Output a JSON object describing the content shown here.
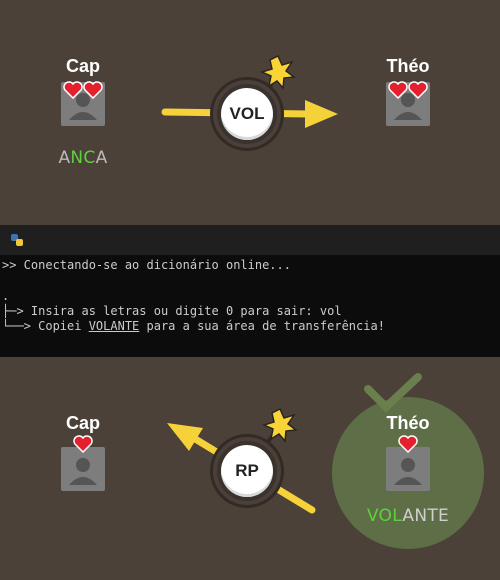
{
  "top_panel": {
    "left_player": {
      "name": "Cap",
      "hearts": 2,
      "word_prefix": "A",
      "word_highlight": "NC",
      "word_suffix": "A"
    },
    "right_player": {
      "name": "Théo",
      "hearts": 2
    },
    "bomb_label": "VOL",
    "arrow_direction": "right"
  },
  "console": {
    "titlebar_icon": "python-icon",
    "line1": ">> Conectando-se ao dicionário online...",
    "line2": ".",
    "line3": "├─> Insira as letras ou digite 0 para sair: vol",
    "line4_prefix": "└──> Copiei ",
    "line4_word": "VOLANTE",
    "line4_suffix": " para a sua área de transferência!"
  },
  "bottom_panel": {
    "left_player": {
      "name": "Cap",
      "hearts": 1
    },
    "right_player": {
      "name": "Théo",
      "hearts": 1,
      "word_highlight": "VOL",
      "word_rest": "ANTE"
    },
    "bomb_label": "RP",
    "arrow_direction": "up-left"
  },
  "colors": {
    "background": "#4b4139",
    "arrow": "#f5d23a",
    "highlight_green": "#5dd13c",
    "success_circle": "#5e6f48",
    "heart": "#e4202f"
  }
}
